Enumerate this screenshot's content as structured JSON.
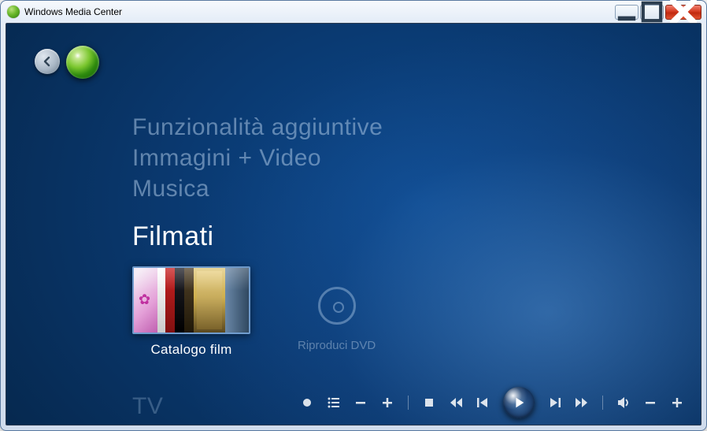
{
  "window": {
    "title": "Windows Media Center"
  },
  "menu": {
    "above": [
      "Funzionalità aggiuntive",
      "Immagini + Video",
      "Musica"
    ],
    "active": "Filmati",
    "below": "TV"
  },
  "tiles": {
    "catalog_label": "Catalogo film",
    "dvd_label": "Riproduci DVD"
  },
  "icons": {
    "back": "back-arrow",
    "logo": "wmc-orb",
    "record": "●",
    "guide": "guide",
    "ch_down": "−",
    "ch_up": "+",
    "stop": "■",
    "rewind": "«",
    "prev": "|◀",
    "play": "▶",
    "next": "▶|",
    "fwd": "»",
    "mute": "speaker",
    "vol_down": "−",
    "vol_up": "+"
  }
}
